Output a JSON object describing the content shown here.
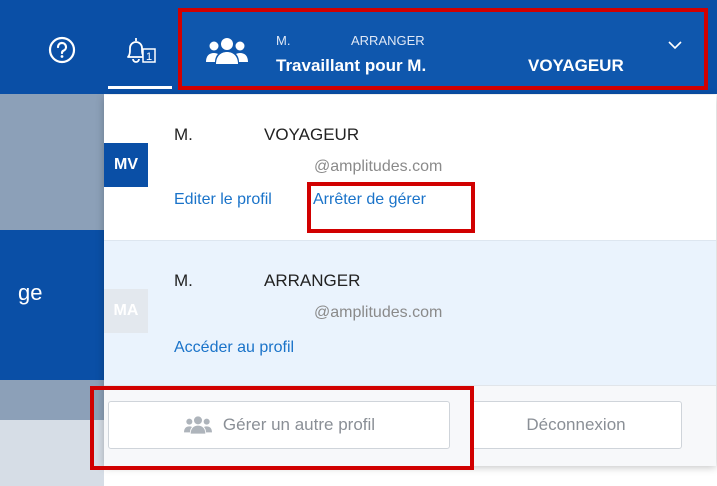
{
  "header": {
    "help_icon": "question-circle-icon",
    "notifications": {
      "icon": "bell-icon",
      "count": "1"
    },
    "account": {
      "icon": "users-icon",
      "user_prefix": "M.",
      "user_role": "ARRANGER",
      "working_for_label": "Travaillant pour M.",
      "working_for_target": "VOYAGEUR",
      "chevron_icon": "chevron-down-icon"
    }
  },
  "background": {
    "partial_text": "ge"
  },
  "dropdown": {
    "current_profile": {
      "avatar": "MV",
      "title": "M.",
      "last_name": "VOYAGEUR",
      "email": "@amplitudes.com",
      "edit_link": "Editer le profil",
      "stop_link": "Arrêter de gérer"
    },
    "own_profile": {
      "avatar": "MA",
      "title": "M.",
      "last_name": "ARRANGER",
      "email": "@amplitudes.com",
      "access_link": "Accéder au profil"
    },
    "footer": {
      "manage_button": "Gérer un autre profil",
      "logout_button": "Déconnexion"
    }
  },
  "colors": {
    "brand": "#0a4fa6",
    "link": "#1a73c9",
    "highlight": "#d10000"
  }
}
